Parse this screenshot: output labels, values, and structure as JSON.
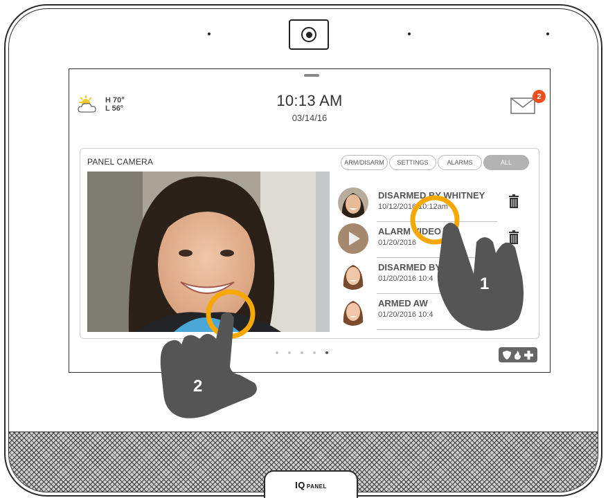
{
  "weather": {
    "high": "H 70°",
    "low": "L 56°",
    "icon": "partly-cloudy-icon"
  },
  "clock": {
    "time": "10:13 AM",
    "date": "03/14/16"
  },
  "messages": {
    "count": "2",
    "icon": "envelope-icon"
  },
  "camera_card": {
    "title": "PANEL CAMERA",
    "filters": [
      {
        "label": "ARM/DISARM",
        "active": false
      },
      {
        "label": "SETTINGS",
        "active": false
      },
      {
        "label": "ALARMS",
        "active": false
      },
      {
        "label": "ALL",
        "active": true
      }
    ],
    "events": [
      {
        "title": "DISARMED BY WHITNEY",
        "time": "10/12/2016 10:12am",
        "thumb": "face-thumb"
      },
      {
        "title": "ALARM VIDEO",
        "time": "01/20/2016",
        "thumb": "video-thumb"
      },
      {
        "title": "DISARMED BY",
        "time": "01/20/2016 10:4",
        "thumb": "face-thumb"
      },
      {
        "title": "ARMED AW",
        "time": "01/20/2016 10:4",
        "thumb": "face-thumb"
      }
    ]
  },
  "pager": {
    "pages": 5,
    "current": 5
  },
  "emergency": {
    "icons": [
      "shield-icon",
      "fire-icon",
      "medical-cross-icon"
    ]
  },
  "annotations": {
    "step1": "1",
    "step2": "2"
  },
  "brand": {
    "logo_text": "IQ",
    "logo_sub": "PANEL"
  },
  "colors": {
    "accent_ring": "#f5a800",
    "badge": "#f04e1e",
    "hand": "#555555"
  }
}
